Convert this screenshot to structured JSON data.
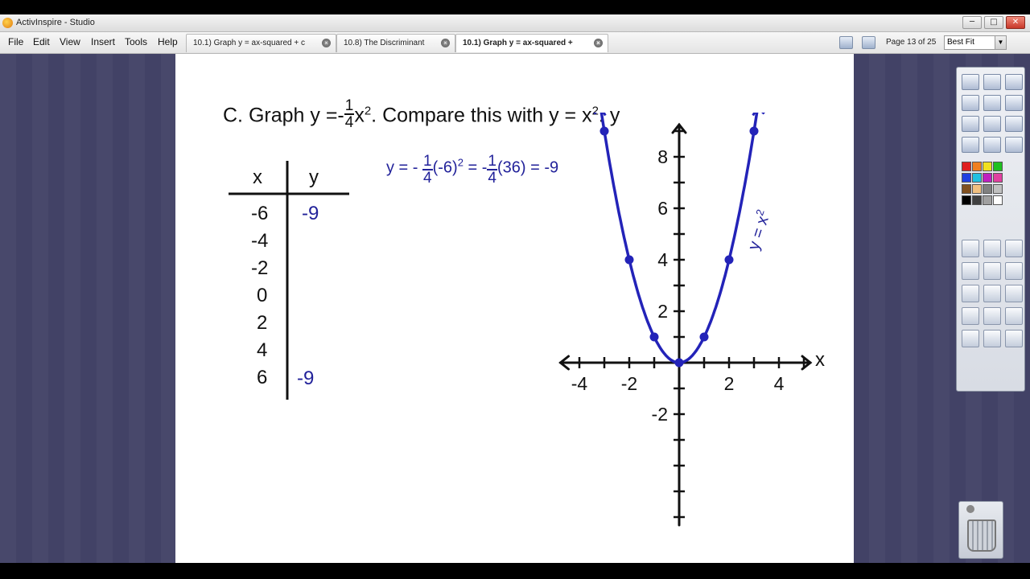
{
  "app": {
    "title": "ActivInspire - Studio",
    "window_buttons": [
      "─",
      "□",
      "✕"
    ]
  },
  "menu": {
    "items": [
      "File",
      "Edit",
      "View",
      "Insert",
      "Tools",
      "Help"
    ]
  },
  "tabs": [
    {
      "label": "10.1) Graph y = ax-squared + c",
      "active": false
    },
    {
      "label": "10.8) The Discriminant",
      "active": false
    },
    {
      "label": "10.1) Graph y = ax-squared +",
      "active": true
    }
  ],
  "toolbar": {
    "page_info": "Page 13 of 25",
    "zoom_value": "Best Fit"
  },
  "slide": {
    "heading_prefix": "C. Graph y =",
    "frac_sign": "-",
    "frac_num": "1",
    "frac_den": "4",
    "heading_var": "x",
    "heading_exp": "2",
    "heading_suffix": ". Compare this with y = x",
    "heading_suffix_exp": "2",
    "heading_end": ". y",
    "table": {
      "x_header": "x",
      "y_header": "y",
      "x_values": [
        "-6",
        "-4",
        "-2",
        "0",
        "2",
        "4",
        "6"
      ],
      "y_values": [
        "-9",
        "",
        "",
        "",
        "",
        "",
        "-9"
      ]
    },
    "work": {
      "lhs": "y = -",
      "frac1_num": "1",
      "frac1_den": "4",
      "paren": "(-6)",
      "exp": "2",
      "eq": "= -",
      "frac2_num": "1",
      "frac2_den": "4",
      "rhs": "(36) = -9"
    },
    "curve_label": "y = x",
    "curve_label_exp": "2"
  },
  "chart_data": {
    "type": "line",
    "xlabel": "x",
    "ylabel": "y",
    "xlim": [
      -4.5,
      5
    ],
    "ylim": [
      -6.5,
      9.5
    ],
    "x_tick_labels": [
      "-4",
      "-2",
      "2",
      "4"
    ],
    "y_tick_labels": [
      "8",
      "6",
      "4",
      "2",
      "-2"
    ],
    "series": [
      {
        "name": "y = x2",
        "x": [
          -3,
          -2,
          -1,
          0,
          1,
          2,
          3
        ],
        "y": [
          9,
          4,
          1,
          0,
          1,
          4,
          9
        ]
      }
    ],
    "curve_color": "#2323b8"
  },
  "colors": {
    "workspace": "#424266",
    "ink_blue": "#22229a"
  }
}
